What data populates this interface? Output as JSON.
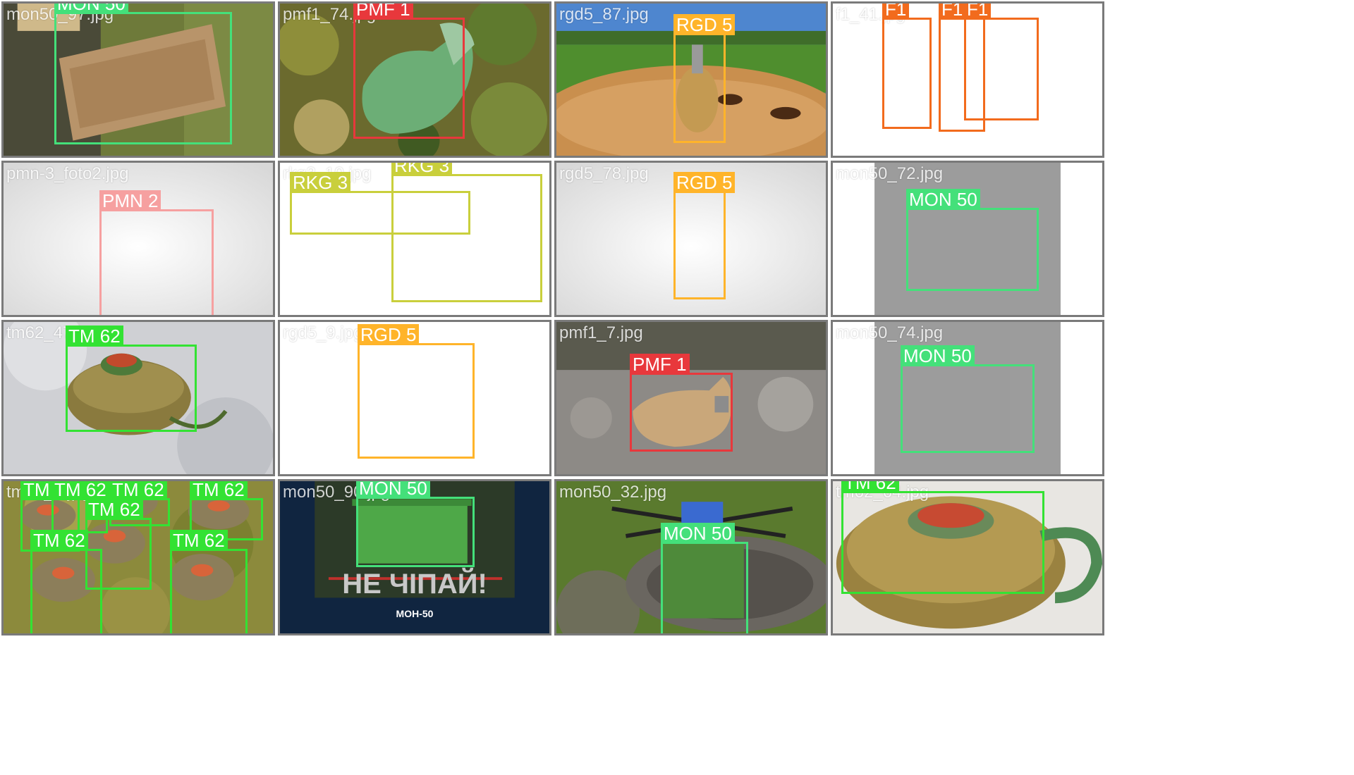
{
  "colors": {
    "MON 50": "#44e07a",
    "PMF 1": "#e8383c",
    "RGD 5": "#ffb42a",
    "F1": "#f26b1d",
    "PMN 2": "#f6a0a0",
    "RKG 3": "#c9cf3c",
    "TM 62": "#33e233"
  },
  "tiles": [
    {
      "file": "mon50_97.jpg",
      "scene": "box-olive",
      "detections": [
        {
          "label": "MON 50"
        }
      ]
    },
    {
      "file": "pmf1_74.jpg",
      "scene": "leaves",
      "detections": [
        {
          "label": "PMF 1"
        }
      ]
    },
    {
      "file": "rgd5_87.jpg",
      "scene": "field",
      "detections": [
        {
          "label": "RGD 5"
        }
      ]
    },
    {
      "file": "f1_41.jpg",
      "scene": "white",
      "detections": [
        {
          "label": "F1"
        },
        {
          "label": "F1"
        },
        {
          "label": "F1"
        }
      ]
    },
    {
      "file": "pmn-3_foto2.jpg",
      "scene": "studio",
      "detections": [
        {
          "label": "PMN 2"
        }
      ]
    },
    {
      "file": "rkg3_10.jpg",
      "scene": "white",
      "detections": [
        {
          "label": "RKG 3"
        },
        {
          "label": "RKG 3"
        }
      ]
    },
    {
      "file": "rgd5_78.jpg",
      "scene": "studio",
      "detections": [
        {
          "label": "RGD 5"
        }
      ]
    },
    {
      "file": "mon50_72.jpg",
      "scene": "gray-panel",
      "detections": [
        {
          "label": "MON 50"
        }
      ]
    },
    {
      "file": "tm62_47.jpg",
      "scene": "snow",
      "detections": [
        {
          "label": "TM 62"
        }
      ]
    },
    {
      "file": "rgd5_9.jpg",
      "scene": "white",
      "detections": [
        {
          "label": "RGD 5"
        }
      ]
    },
    {
      "file": "pmf1_7.jpg",
      "scene": "gravel",
      "detections": [
        {
          "label": "PMF 1"
        }
      ]
    },
    {
      "file": "mon50_74.jpg",
      "scene": "gray-panel",
      "detections": [
        {
          "label": "MON 50"
        }
      ]
    },
    {
      "file": "tm62_1.jpg",
      "scene": "grass",
      "detections": [
        {
          "label": "TM 62"
        },
        {
          "label": "TM 62"
        },
        {
          "label": "TM 62"
        },
        {
          "label": "TM 62"
        },
        {
          "label": "TM 62"
        },
        {
          "label": "TM 62"
        },
        {
          "label": "TM 62"
        }
      ]
    },
    {
      "file": "mon50_90.jpg",
      "scene": "poster",
      "poster_text": "НЕ ЧІПАЙ!",
      "poster_caption": "МОН-50",
      "detections": [
        {
          "label": "MON 50"
        }
      ]
    },
    {
      "file": "mon50_32.jpg",
      "scene": "manhole",
      "detections": [
        {
          "label": "MON 50"
        }
      ]
    },
    {
      "file": "tm62_64.jpg",
      "scene": "tm-closeup",
      "detections": [
        {
          "label": "TM 62"
        }
      ]
    }
  ]
}
